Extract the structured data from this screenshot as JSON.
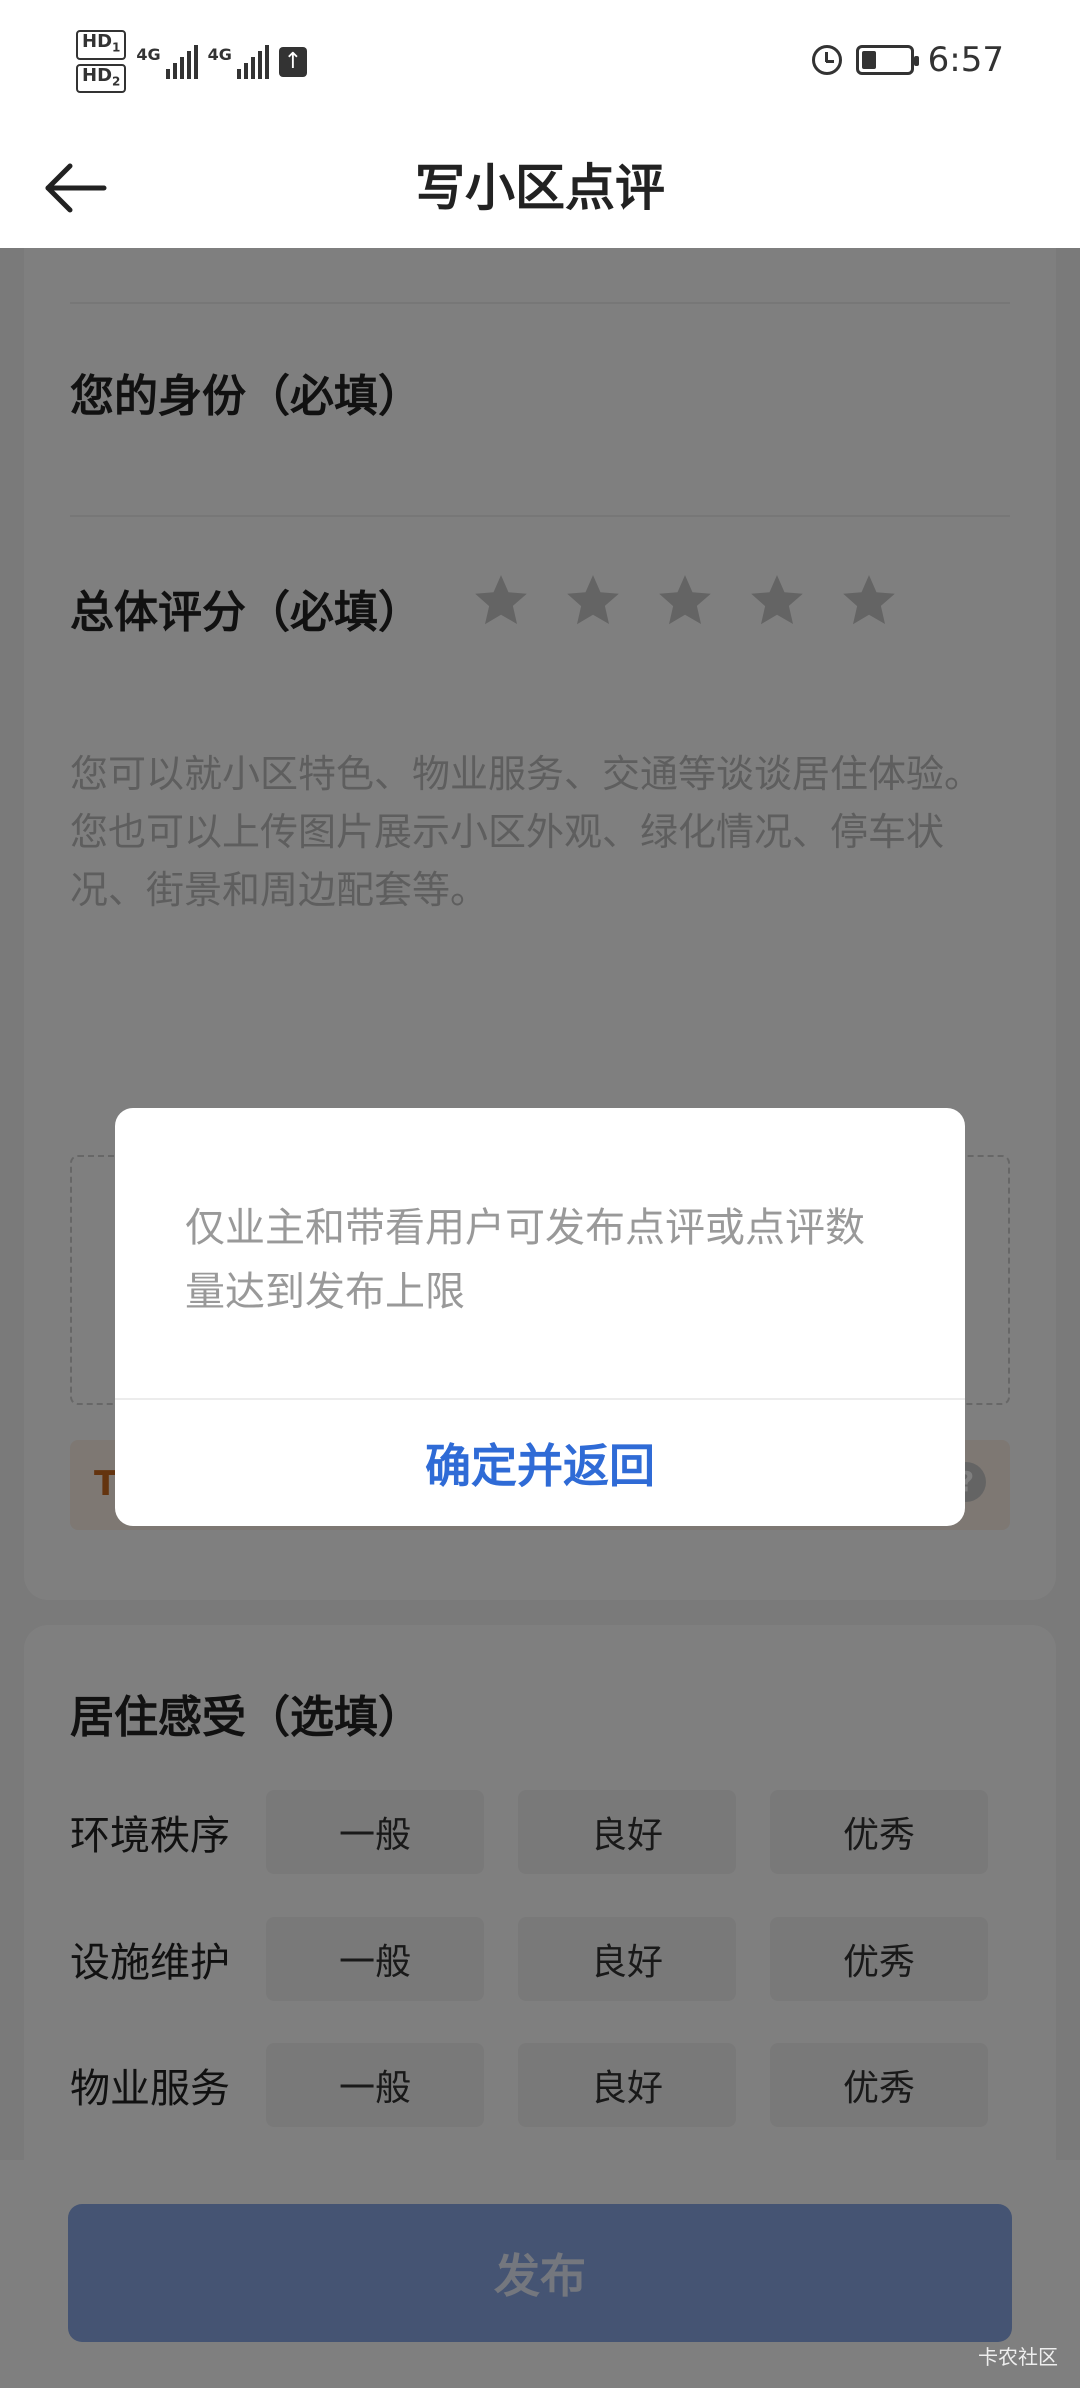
{
  "status_bar": {
    "sim1": "HD",
    "sim1_index": "1",
    "sim2": "HD",
    "sim2_index": "2",
    "net1": "4G",
    "net2": "4G",
    "time": "6:57"
  },
  "nav": {
    "title": "写小区点评"
  },
  "form": {
    "identity_label": "您的身份（必填）",
    "rating_label": "总体评分（必填）",
    "rating_value": 0,
    "rating_max": 5,
    "placeholder": "您可以就小区特色、物业服务、交通等谈谈居住体验。\n您也可以上传图片展示小区外观、绿化情况、停车状况、街景和周边配套等。",
    "tip_first_char": "T"
  },
  "feeling": {
    "title": "居住感受（选填）",
    "rows": [
      {
        "label": "环境秩序",
        "options": [
          "一般",
          "良好",
          "优秀"
        ]
      },
      {
        "label": "设施维护",
        "options": [
          "一般",
          "良好",
          "优秀"
        ]
      },
      {
        "label": "物业服务",
        "options": [
          "一般",
          "良好",
          "优秀"
        ]
      }
    ]
  },
  "bottom": {
    "publish_label": "发布",
    "watermark": "卡农社区"
  },
  "dialog": {
    "message": "仅业主和带看用户可发布点评或点评数量达到发布上限",
    "confirm_label": "确定并返回"
  },
  "colors": {
    "accent": "#2f6bd6",
    "publish_bg": "#8aa9e6"
  }
}
